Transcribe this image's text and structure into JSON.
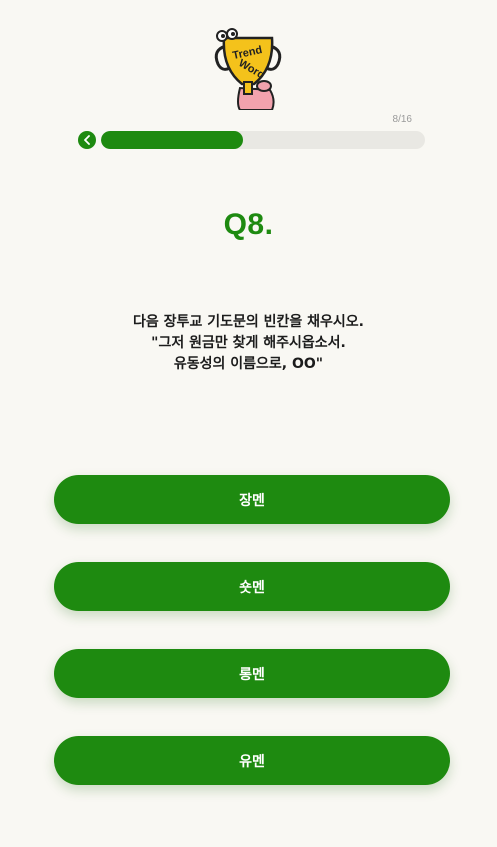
{
  "logo": {
    "text": "Trend Word",
    "icon": "trophy-icon"
  },
  "progress": {
    "label": "8/16",
    "fraction": 0.4375
  },
  "question": {
    "number": "Q8.",
    "lines": [
      "다음 장투교 기도문의 빈칸을 채우시오.",
      "\"그저 원금만 찾게 해주시옵소서.",
      "유동성의 이름으로, OO\""
    ]
  },
  "options": [
    {
      "label": "장멘"
    },
    {
      "label": "숏멘"
    },
    {
      "label": "롱멘"
    },
    {
      "label": "유멘"
    }
  ],
  "colors": {
    "accent": "#1e8a10",
    "background": "#f9f8f3",
    "track": "#e9e8e3"
  }
}
